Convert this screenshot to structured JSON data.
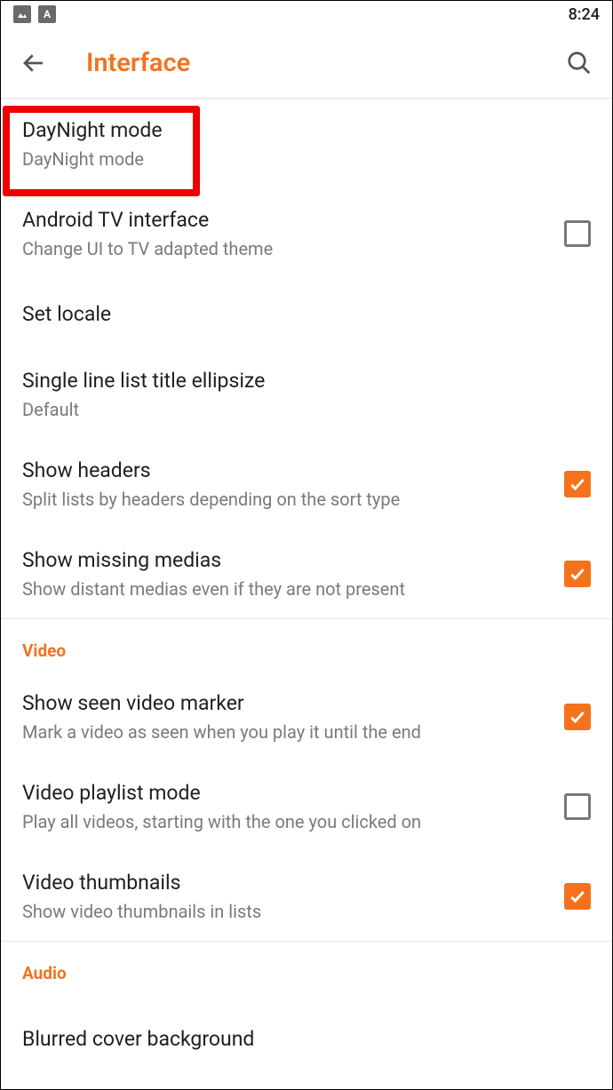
{
  "status": {
    "time": "8:24"
  },
  "header": {
    "title": "Interface"
  },
  "settings": {
    "daynight": {
      "title": "DayNight mode",
      "sub": "DayNight mode"
    },
    "androidtv": {
      "title": "Android TV interface",
      "sub": "Change UI to TV adapted theme"
    },
    "locale": {
      "title": "Set locale"
    },
    "ellipsize": {
      "title": "Single line list title ellipsize",
      "sub": "Default"
    },
    "headers": {
      "title": "Show headers",
      "sub": "Split lists by headers depending on the sort type"
    },
    "missing": {
      "title": "Show missing medias",
      "sub": "Show distant medias even if they are not present"
    }
  },
  "sections": {
    "video": "Video",
    "audio": "Audio"
  },
  "video": {
    "seen": {
      "title": "Show seen video marker",
      "sub": "Mark a video as seen when you play it until the end"
    },
    "playlist": {
      "title": "Video playlist mode",
      "sub": "Play all videos, starting with the one you clicked on"
    },
    "thumbs": {
      "title": "Video thumbnails",
      "sub": "Show video thumbnails in lists"
    }
  },
  "audio": {
    "blurred": {
      "title": "Blurred cover background"
    }
  }
}
